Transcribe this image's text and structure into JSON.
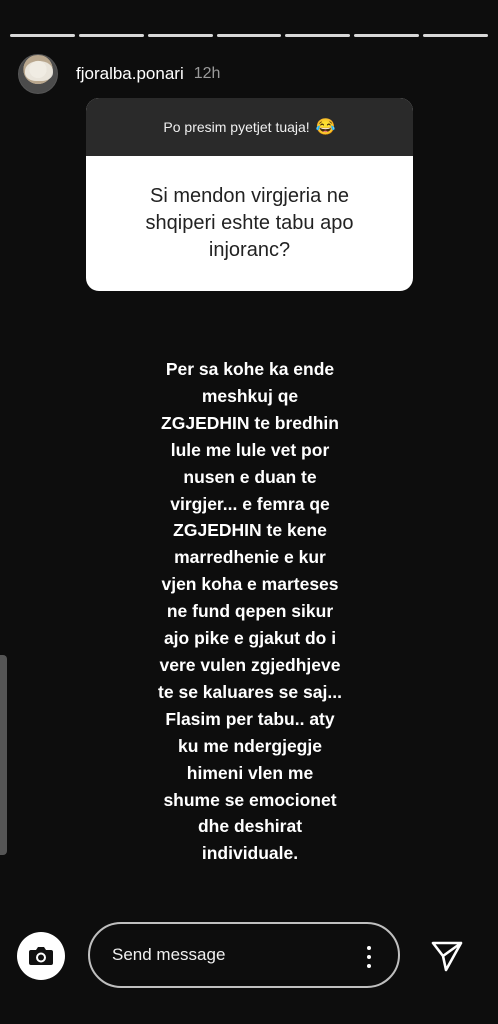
{
  "story": {
    "segments": 7,
    "active_segment": 1,
    "username": "fjoralba.ponari",
    "time": "12h"
  },
  "question_card": {
    "header": "Po presim pyetjet tuaja!",
    "header_emoji": "😂",
    "question": "Si mendon virgjeria ne shqiperi eshte tabu apo injoranc?"
  },
  "answer": {
    "text": "Per sa kohe ka ende\nmeshkuj qe\nZGJEDHIN te bredhin\nlule me lule vet por\nnusen e duan te\nvirgjer... e femra qe\nZGJEDHIN te kene\nmarredhenie e kur\nvjen koha e marteses\nne fund qepen sikur\najo pike e gjakut do i\nvere vulen zgjedhjeve\nte se kaluares se saj...\nFlasim per tabu.. aty\nku me ndergjegje\nhimeni vlen me\nshume se emocionet\ndhe deshirat\nindividuale."
  },
  "footer": {
    "message_placeholder": "Send message",
    "camera_icon": "camera-icon",
    "more_icon": "more-vertical-icon",
    "send_icon": "send-icon"
  },
  "colors": {
    "background": "#0d0d0d",
    "card_header": "#2a2a2a",
    "card_body": "#ffffff",
    "progress": "#d8d8d8"
  }
}
